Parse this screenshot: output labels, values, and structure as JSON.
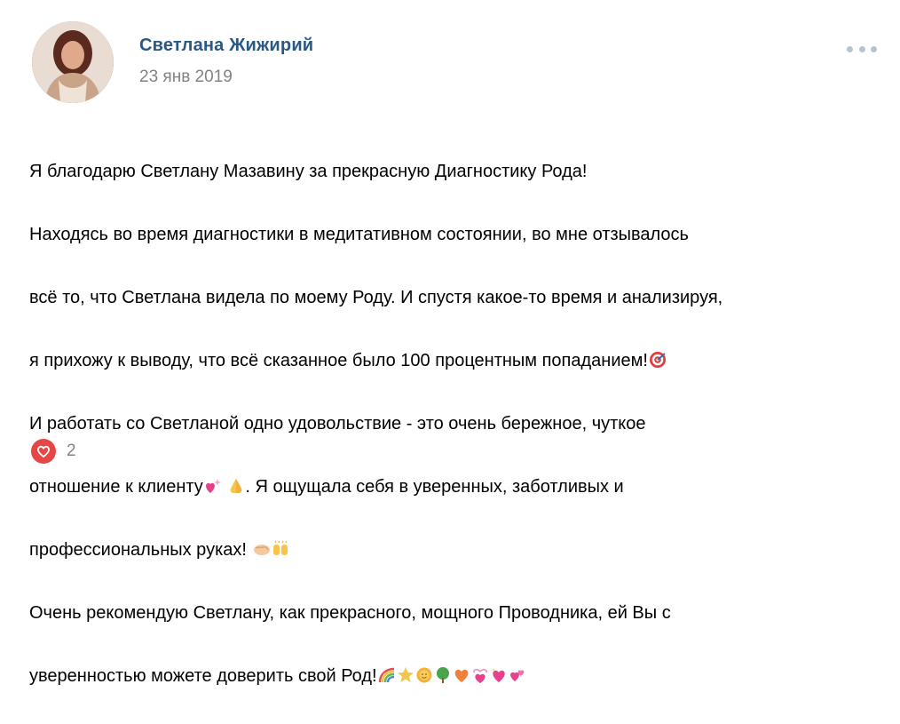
{
  "post": {
    "author": "Светлана Жижирий",
    "date": "23 янв 2019",
    "lines": [
      "Я благодарю Светлану Мазавину за прекрасную Диагностику Рода!",
      "Находясь во время диагностики в медитативном состоянии, во мне отзывалось",
      "всё то, что Светлана видела по моему Роду. И спустя какое-то время и анализируя,",
      "я прихожу к выводу, что всё сказанное было 100 процентным попаданием!",
      "И работать со Светланой одно удовольствие - это очень бережное, чуткое",
      "отношение к клиенту",
      ". Я ощущала себя в уверенных, заботливых и",
      "профессиональных руках!",
      "Очень рекомендую Светлану, как прекрасного, мощного Проводника, ей Вы с",
      "уверенностью можете доверить свой Род!"
    ],
    "emoji": {
      "line4": [
        "direct-hit-icon"
      ],
      "line6": [
        "heart-sparkle-icon",
        "praying-hands-icon"
      ],
      "line7": [
        "handshake-icon",
        "raised-hands-icon"
      ],
      "line9": [
        "rainbow-icon",
        "star-icon",
        "sun-icon",
        "tree-icon",
        "orange-heart-icon",
        "ribbon-heart-icon",
        "sparkling-heart-icon",
        "two-hearts-icon"
      ]
    }
  },
  "likes": {
    "count": "2",
    "icon": "heart-icon",
    "color": "#e64646"
  },
  "colors": {
    "author": "#2a5885",
    "meta": "#828282"
  },
  "menu_icon": "more-dots-icon"
}
